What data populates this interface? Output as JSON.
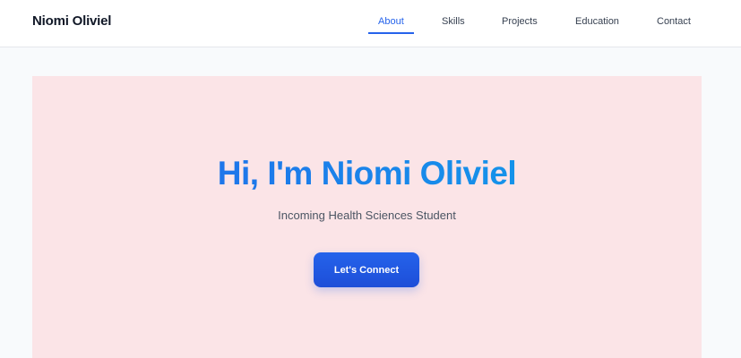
{
  "header": {
    "brand": "Niomi Oliviel",
    "nav": [
      {
        "label": "About",
        "active": true
      },
      {
        "label": "Skills",
        "active": false
      },
      {
        "label": "Projects",
        "active": false
      },
      {
        "label": "Education",
        "active": false
      },
      {
        "label": "Contact",
        "active": false
      }
    ]
  },
  "hero": {
    "title": "Hi, I'm Niomi Oliviel",
    "subtitle": "Incoming Health Sciences Student",
    "cta_label": "Let's Connect"
  },
  "colors": {
    "accent": "#2563eb",
    "hero_background": "#fbe4e7",
    "page_background": "#f8fafc"
  }
}
